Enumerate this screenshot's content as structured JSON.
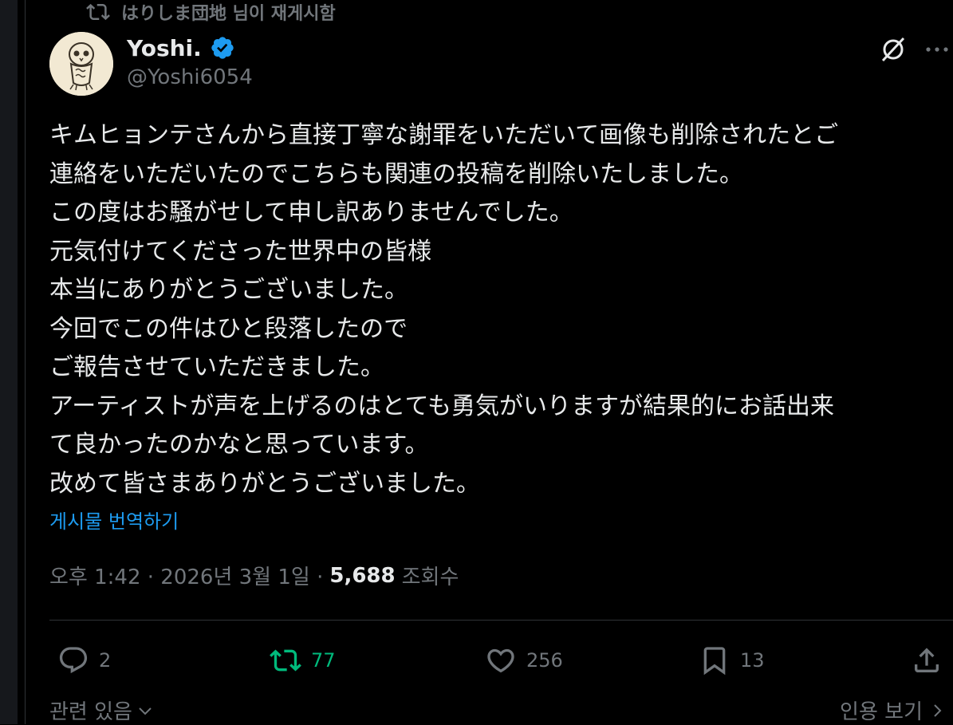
{
  "repost": {
    "text": "はりしま団地 님이 재게시함",
    "icon": "repost-icon"
  },
  "author": {
    "name": "Yoshi.",
    "handle": "@Yoshi6054",
    "verified": true,
    "verified_color": "#1d9bf0"
  },
  "header_icons": {
    "grok": "grok-icon",
    "more": "more-icon"
  },
  "tweet": {
    "lines": [
      "キムヒョンテさんから直接丁寧な謝罪をいただいて画像も削除されたとご",
      "連絡をいただいたのでこちらも関連の投稿を削除いたしました。",
      "この度はお騒がせして申し訳ありませんでした。",
      "元気付けてくださった世界中の皆様",
      "本当にありがとうございました。",
      "今回でこの件はひと段落したので",
      "ご報告させていただきました。",
      "アーティストが声を上げるのはとても勇気がいりますが結果的にお話出来",
      "て良かったのかなと思っています。",
      "改めて皆さまありがとうございました。"
    ],
    "translate_label": "게시물 번역하기"
  },
  "meta": {
    "time_date": "오후 1:42 · 2026년 3월 1일 ·",
    "views": "5,688",
    "views_label": "조회수"
  },
  "actions": {
    "reply_count": "2",
    "repost_count": "77",
    "like_count": "256",
    "bookmark_count": "13"
  },
  "footer": {
    "related_label": "관련 있음",
    "quotes_label": "인용 보기"
  },
  "colors": {
    "background": "#000000",
    "text": "#e7e9ea",
    "secondary": "#71767b",
    "accent": "#1d9bf0",
    "repost_green": "#00ba7c"
  }
}
